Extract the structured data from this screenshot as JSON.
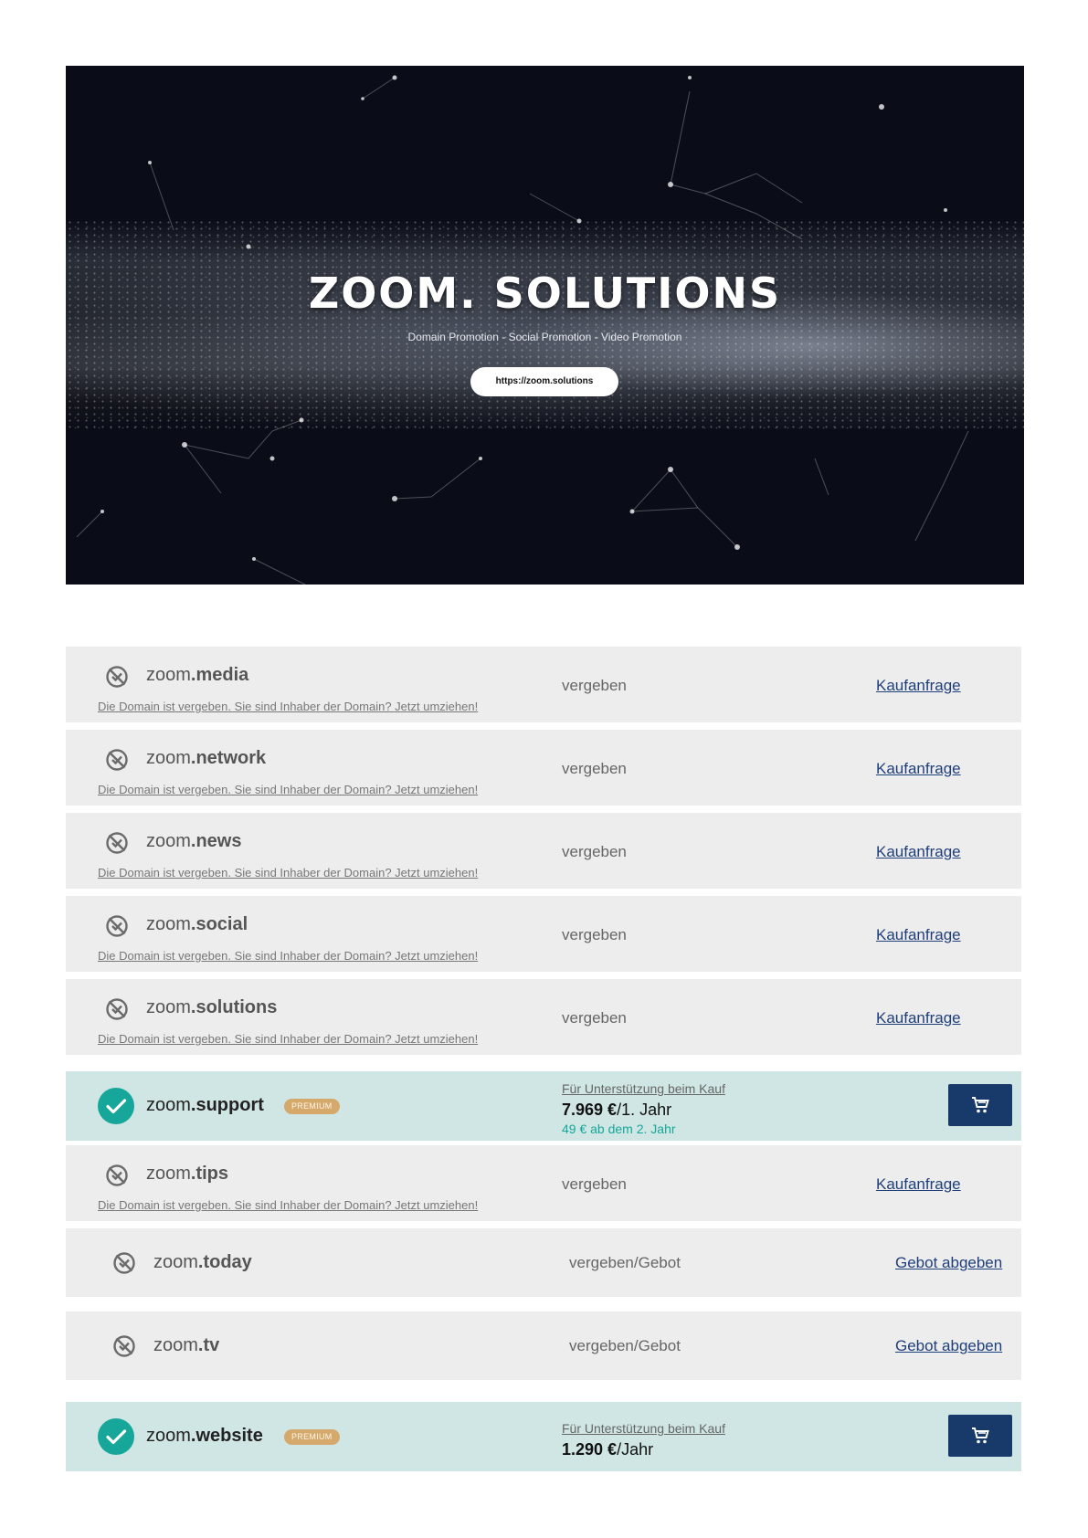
{
  "hero": {
    "title": "ZOOM. SOLUTIONS",
    "subtitle": "Domain Promotion - Social Promotion - Video Promotion",
    "button_label": "https://zoom.solutions"
  },
  "common": {
    "owner_note": "Die Domain ist vergeben. Sie sind Inhaber der Domain? Jetzt umziehen!",
    "support_note": "Für Unterstützung beim Kauf",
    "premium_badge": "PREMIUM",
    "status_taken": "vergeben",
    "status_taken_bid": "vergeben/Gebot",
    "action_inquiry": "Kaufanfrage",
    "action_bid": "Gebot abgeben"
  },
  "domains": [
    {
      "sld": "zoom",
      "tld": ".media"
    },
    {
      "sld": "zoom",
      "tld": ".network"
    },
    {
      "sld": "zoom",
      "tld": ".news"
    },
    {
      "sld": "zoom",
      "tld": ".social"
    },
    {
      "sld": "zoom",
      "tld": ".solutions"
    },
    {
      "sld": "zoom",
      "tld": ".support",
      "price_value": "7.969 €",
      "price_period": "/1. Jahr",
      "renewal": "49 € ab dem 2. Jahr"
    },
    {
      "sld": "zoom",
      "tld": ".tips"
    },
    {
      "sld": "zoom",
      "tld": ".today"
    },
    {
      "sld": "zoom",
      "tld": ".tv"
    },
    {
      "sld": "zoom",
      "tld": ".website",
      "price_value": "1.290 €",
      "price_period": "/Jahr"
    }
  ],
  "icons": {
    "taken": "not-available-icon",
    "available": "check-icon",
    "cart": "cart-icon"
  },
  "colors": {
    "taken_row": "#ededed",
    "available_row": "#cfe6e4",
    "accent_teal": "#17a79a",
    "cart_button": "#173a6b",
    "link_blue": "#1f3f7a",
    "premium_badge": "#d5a86b"
  }
}
